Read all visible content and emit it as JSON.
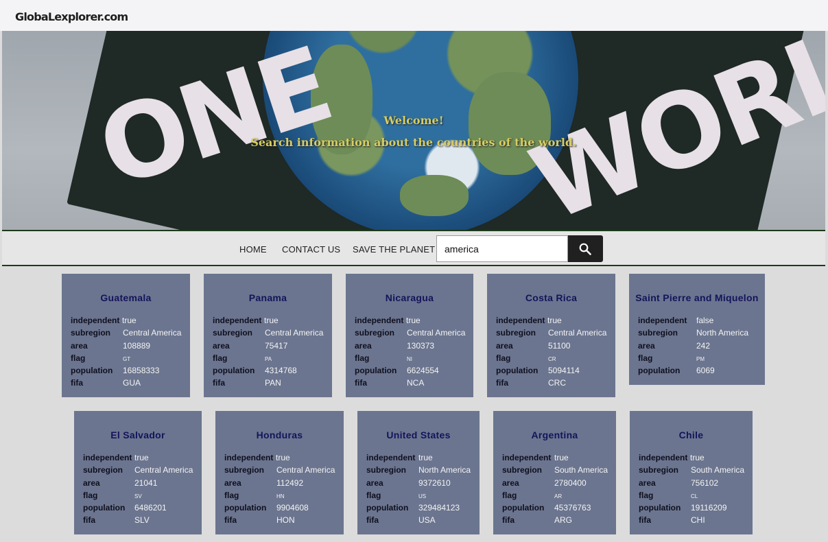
{
  "header": {
    "logo": "GlobaLexplorer.com"
  },
  "hero": {
    "painted_words": [
      "ONE",
      "WORLD"
    ],
    "welcome": "Welcome!",
    "subtitle": "Search information about the countries of the world."
  },
  "nav": {
    "links": [
      "HOME",
      "CONTACT US",
      "SAVE THE PLANET"
    ],
    "search_value": "america",
    "search_button_icon": "search-icon"
  },
  "labels": {
    "independent": "independent",
    "subregion": "subregion",
    "area": "area",
    "flag": "flag",
    "population": "population",
    "fifa": "fifa"
  },
  "countries": [
    {
      "name": "Guatemala",
      "independent": "true",
      "subregion": "Central America",
      "area": "108889",
      "flag": "GT",
      "population": "16858333",
      "fifa": "GUA"
    },
    {
      "name": "Panama",
      "independent": "true",
      "subregion": "Central America",
      "area": "75417",
      "flag": "PA",
      "population": "4314768",
      "fifa": "PAN"
    },
    {
      "name": "Nicaragua",
      "independent": "true",
      "subregion": "Central America",
      "area": "130373",
      "flag": "NI",
      "population": "6624554",
      "fifa": "NCA"
    },
    {
      "name": "Costa Rica",
      "independent": "true",
      "subregion": "Central America",
      "area": "51100",
      "flag": "CR",
      "population": "5094114",
      "fifa": "CRC"
    },
    {
      "name": "Saint Pierre and Miquelon",
      "independent": "false",
      "subregion": "North America",
      "area": "242",
      "flag": "PM",
      "population": "6069",
      "fifa": ""
    },
    {
      "name": "El Salvador",
      "independent": "true",
      "subregion": "Central America",
      "area": "21041",
      "flag": "SV",
      "population": "6486201",
      "fifa": "SLV"
    },
    {
      "name": "Honduras",
      "independent": "true",
      "subregion": "Central America",
      "area": "112492",
      "flag": "HN",
      "population": "9904608",
      "fifa": "HON"
    },
    {
      "name": "United States",
      "independent": "true",
      "subregion": "North America",
      "area": "9372610",
      "flag": "US",
      "population": "329484123",
      "fifa": "USA"
    },
    {
      "name": "Argentina",
      "independent": "true",
      "subregion": "South America",
      "area": "2780400",
      "flag": "AR",
      "population": "45376763",
      "fifa": "ARG"
    },
    {
      "name": "Chile",
      "independent": "true",
      "subregion": "South America",
      "area": "756102",
      "flag": "CL",
      "population": "19116209",
      "fifa": "CHI"
    }
  ]
}
